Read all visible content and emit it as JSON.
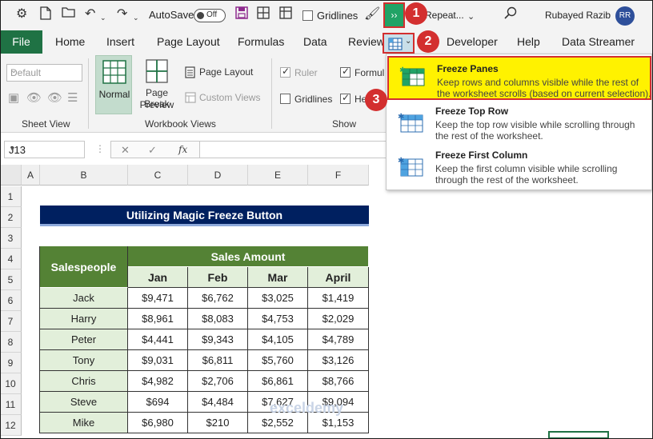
{
  "qat": {
    "autosave_label": "AutoSave",
    "autosave_state": "Off",
    "gridlines_label": "Gridlines",
    "more_commands_glyph": "››",
    "repeat_label": "Repeat...",
    "user_name": "Rubayed Razib",
    "user_initials": "RR"
  },
  "tabs": {
    "file": "File",
    "items": [
      "Home",
      "Insert",
      "Page Layout",
      "Formulas",
      "Data",
      "Review",
      "Developer",
      "Help",
      "Data Streamer"
    ]
  },
  "ribbon": {
    "sheet_view": {
      "select_value": "Default",
      "group_label": "Sheet View"
    },
    "workbook_views": {
      "normal": "Normal",
      "page_break_line1": "Page Break",
      "page_break_line2": "Preview",
      "page_layout": "Page Layout",
      "custom_views": "Custom Views",
      "group_label": "Workbook Views"
    },
    "show": {
      "ruler": "Ruler",
      "formula_bar": "Formul",
      "gridlines": "Gridlines",
      "headings": "He",
      "group_label": "Show"
    }
  },
  "formula_bar": {
    "name_box": "J13",
    "fx_label": "fx",
    "cancel_glyph": "✕",
    "enter_glyph": "✓"
  },
  "grid": {
    "columns": [
      "A",
      "B",
      "C",
      "D",
      "E",
      "F"
    ],
    "rows": [
      "1",
      "2",
      "3",
      "4",
      "5",
      "6",
      "7",
      "8",
      "9",
      "10",
      "11",
      "12"
    ]
  },
  "sheet": {
    "title": "Utilizing Magic Freeze Button",
    "header_salespeople": "Salespeople",
    "header_sales_amount": "Sales Amount",
    "months": [
      "Jan",
      "Feb",
      "Mar",
      "April"
    ],
    "rows": [
      {
        "name": "Jack",
        "values": [
          "$9,471",
          "$6,762",
          "$3,025",
          "$1,419"
        ]
      },
      {
        "name": "Harry",
        "values": [
          "$8,961",
          "$8,083",
          "$4,753",
          "$2,029"
        ]
      },
      {
        "name": "Peter",
        "values": [
          "$4,441",
          "$9,343",
          "$4,105",
          "$4,789"
        ]
      },
      {
        "name": "Tony",
        "values": [
          "$9,031",
          "$6,811",
          "$5,760",
          "$3,126"
        ]
      },
      {
        "name": "Chris",
        "values": [
          "$4,982",
          "$2,706",
          "$6,861",
          "$8,766"
        ]
      },
      {
        "name": "Steve",
        "values": [
          "$694",
          "$4,484",
          "$7,627",
          "$9,094"
        ]
      },
      {
        "name": "Mike",
        "values": [
          "$6,980",
          "$210",
          "$2,552",
          "$1,153"
        ]
      }
    ]
  },
  "freeze_menu": {
    "items": [
      {
        "title": "Freeze Panes",
        "desc_line1": "Keep rows and columns visible while the rest of",
        "desc_line2": "the worksheet scrolls (based on current selection)."
      },
      {
        "title": "Freeze Top Row",
        "desc_line1": "Keep the top row visible while scrolling through",
        "desc_line2": "the rest of the worksheet."
      },
      {
        "title": "Freeze First Column",
        "desc_line1": "Keep the first column visible while scrolling",
        "desc_line2": "through the rest of the worksheet."
      }
    ]
  },
  "badges": [
    "1",
    "2",
    "3"
  ],
  "watermark": "exceldemy",
  "colors": {
    "excel_green": "#1f7244",
    "header_green": "#548235",
    "light_green": "#e2efda",
    "title_navy": "#002060",
    "highlight_yellow": "#fff200",
    "annotation_red": "#d32f2f"
  }
}
